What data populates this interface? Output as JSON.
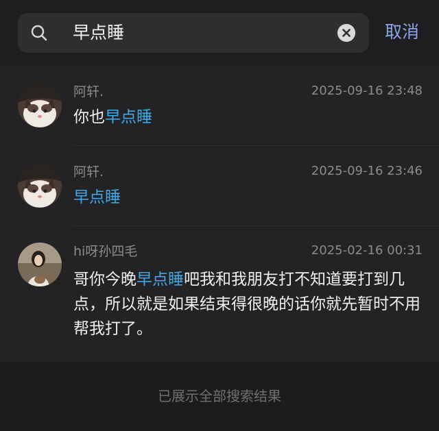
{
  "search": {
    "query": "早点睡",
    "cancel_label": "取消"
  },
  "results": [
    {
      "name": "阿轩.",
      "time": "2025-09-16 23:48",
      "msg_before": "你也",
      "msg_highlight": "早点睡",
      "msg_after": ""
    },
    {
      "name": "阿轩.",
      "time": "2025-09-16 23:46",
      "msg_before": "",
      "msg_highlight": "早点睡",
      "msg_after": ""
    },
    {
      "name": "hi呀孙四毛",
      "time": "2025-02-16 00:31",
      "msg_before": "哥你今晚",
      "msg_highlight": "早点睡",
      "msg_after": "吧我和我朋友打不知道要打到几点，所以就是如果结束得很晚的话你就先暂时不用帮我打了。"
    }
  ],
  "footer": {
    "text": "已展示全部搜索结果"
  },
  "colors": {
    "highlight": "#3fa9e8",
    "cancel": "#8aa6e8",
    "background": "#1c1c1e"
  }
}
